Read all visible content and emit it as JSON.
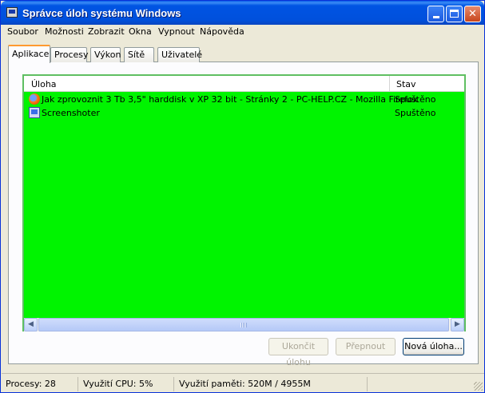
{
  "window": {
    "title": "Správce úloh systému Windows",
    "icon": "task-manager-icon",
    "controls": {
      "minimize": "minimize-icon",
      "maximize": "maximize-icon",
      "close": "✕"
    }
  },
  "menu": [
    "Soubor",
    "Možnosti",
    "Zobrazit",
    "Okna",
    "Vypnout",
    "Nápověda"
  ],
  "tabs": [
    {
      "label": "Aplikace",
      "active": true
    },
    {
      "label": "Procesy",
      "active": false
    },
    {
      "label": "Výkon",
      "active": false
    },
    {
      "label": "Sítě",
      "active": false
    },
    {
      "label": "Uživatelé",
      "active": false
    }
  ],
  "applications": {
    "columns": {
      "task": "Úloha",
      "status": "Stav"
    },
    "rows": [
      {
        "icon": "firefox-icon",
        "task": "Jak zprovoznit 3 Tb 3,5\" harddisk v XP 32 bit - Stránky 2 - PC-HELP.CZ - Mozilla Firefox",
        "status": "Spuštěno"
      },
      {
        "icon": "screenshoter-icon",
        "task": "Screenshoter",
        "status": "Spuštěno"
      }
    ],
    "background_color": "#00f400"
  },
  "buttons": {
    "end_task": "Ukončit úlohu",
    "switch_to": "Přepnout",
    "new_task": "Nová úloha..."
  },
  "statusbar": {
    "processes": "Procesy: 28",
    "cpu": "Využití CPU: 5%",
    "memory": "Využití paměti: 520M / 4955M"
  }
}
